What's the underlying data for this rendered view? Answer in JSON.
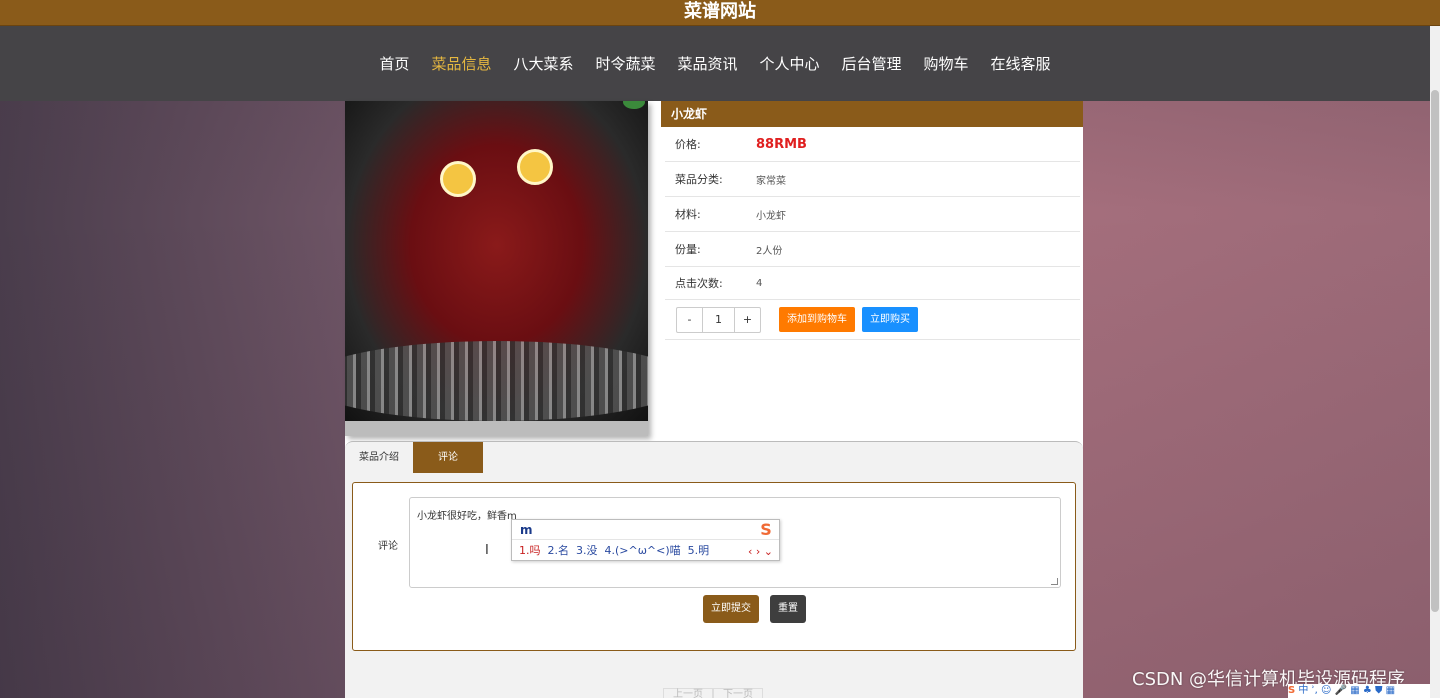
{
  "site_title": "菜谱网站",
  "nav": {
    "items": [
      {
        "label": "首页"
      },
      {
        "label": "菜品信息",
        "active": true
      },
      {
        "label": "八大菜系"
      },
      {
        "label": "时令蔬菜"
      },
      {
        "label": "菜品资讯"
      },
      {
        "label": "个人中心"
      },
      {
        "label": "后台管理"
      },
      {
        "label": "购物车"
      },
      {
        "label": "在线客服"
      }
    ]
  },
  "dish": {
    "name": "小龙虾",
    "price_label": "价格:",
    "price_value": "88RMB",
    "category_label": "菜品分类:",
    "category_value": "家常菜",
    "ingredients_label": "材料:",
    "ingredients_value": "小龙虾",
    "portion_label": "份量:",
    "portion_value": "2人份",
    "clicks_label": "点击次数:",
    "clicks_value": "4"
  },
  "quantity": {
    "minus": "-",
    "value": "1",
    "plus": "+"
  },
  "buttons": {
    "add_to_cart": "添加到购物车",
    "buy_now": "立即购买",
    "submit": "立即提交",
    "reset": "重置"
  },
  "tabs": [
    {
      "label": "菜品介绍"
    },
    {
      "label": "评论",
      "active": true
    }
  ],
  "comment": {
    "label": "评论",
    "text": "小龙虾很好吃，鲜香m"
  },
  "ime": {
    "input": "m",
    "logo": "S",
    "candidates": [
      "1.吗",
      "2.名",
      "3.没",
      "4.(>^ω^<)喵",
      "5.明"
    ],
    "nav": "‹ › ⌄"
  },
  "pager": {
    "prev": "上一页",
    "next": "下一页"
  },
  "watermark": "CSDN @华信计算机毕设源码程序",
  "tray": {
    "logo": "S",
    "icons": "中 ʾ, ☺ 🎤 ▦ ♣ ⛊ ▦"
  },
  "colors": {
    "brand_brown": "#8a5b1a",
    "nav_bg": "#454447",
    "active_nav": "#e6b840",
    "price_red": "#e02020",
    "cart_orange": "#ff7a00",
    "buy_blue": "#1890ff"
  }
}
